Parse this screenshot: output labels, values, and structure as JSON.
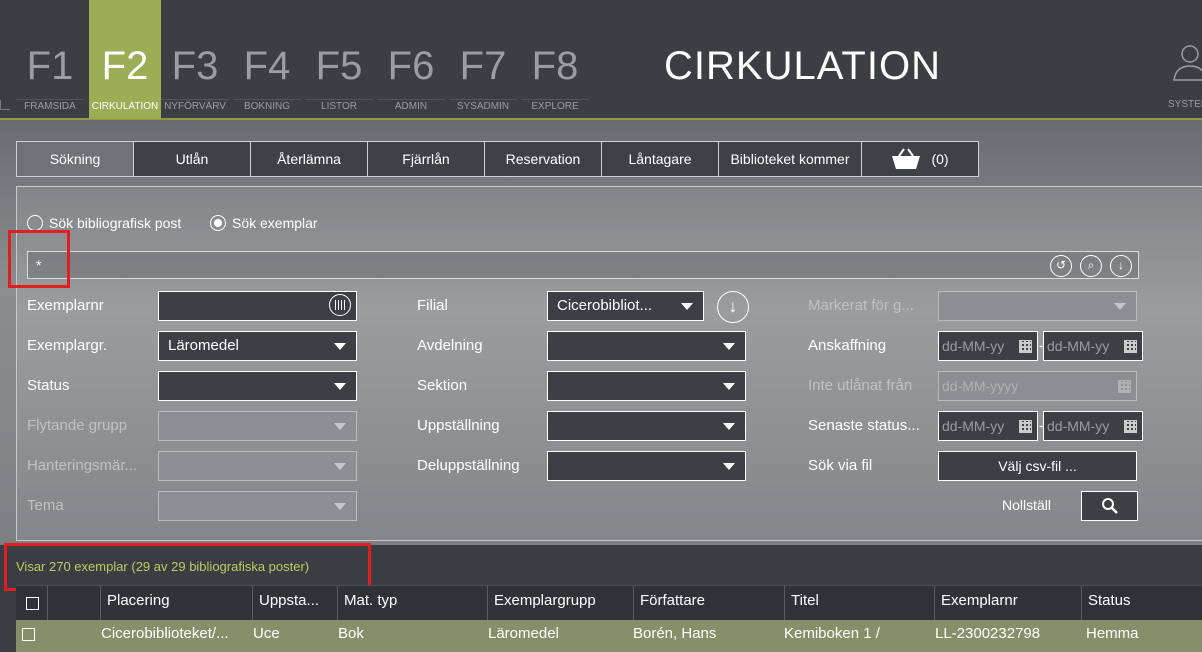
{
  "nav": {
    "keys": [
      {
        "key": "F1",
        "label": "FRAMSIDA"
      },
      {
        "key": "F2",
        "label": "CIRKULATION"
      },
      {
        "key": "F3",
        "label": "NYFÖRVÄRV"
      },
      {
        "key": "F4",
        "label": "BOKNING"
      },
      {
        "key": "F5",
        "label": "LISTOR"
      },
      {
        "key": "F6",
        "label": "ADMIN"
      },
      {
        "key": "F7",
        "label": "SYSADMIN"
      },
      {
        "key": "F8",
        "label": "EXPLORE"
      }
    ],
    "active": "F2",
    "title": "CIRKULATION",
    "system_label": "SYSTEM"
  },
  "tabs": [
    "Sökning",
    "Utlån",
    "Återlämna",
    "Fjärrlån",
    "Reservation",
    "Låntagare",
    "Biblioteket kommer"
  ],
  "basket": {
    "count": "(0)"
  },
  "search": {
    "radio_bib": "Sök bibliografisk post",
    "radio_ex": "Sök exemplar",
    "query": "*"
  },
  "form": {
    "exemplarnr": {
      "label": "Exemplarnr",
      "value": ""
    },
    "exemplargr": {
      "label": "Exemplargr.",
      "value": "Läromedel"
    },
    "status": {
      "label": "Status",
      "value": ""
    },
    "flytande": {
      "label": "Flytande grupp",
      "value": ""
    },
    "hantering": {
      "label": "Hanteringsmär...",
      "value": ""
    },
    "tema": {
      "label": "Tema",
      "value": ""
    },
    "filial": {
      "label": "Filial",
      "value": "Cicerobibliot..."
    },
    "avdelning": {
      "label": "Avdelning",
      "value": ""
    },
    "sektion": {
      "label": "Sektion",
      "value": ""
    },
    "uppstallning": {
      "label": "Uppställning",
      "value": ""
    },
    "deluppstallning": {
      "label": "Deluppställning",
      "value": ""
    },
    "markerat": {
      "label": "Markerat för g...",
      "value": ""
    },
    "anskaffning": {
      "label": "Anskaffning",
      "from": "dd-MM-yy",
      "to": "dd-MM-yy"
    },
    "inte_utlanat": {
      "label": "Inte utlånat från",
      "value": "dd-MM-yyyy"
    },
    "senaste_status": {
      "label": "Senaste status...",
      "from": "dd-MM-yy",
      "to": "dd-MM-yy"
    },
    "sok_via_fil": {
      "label": "Sök via fil",
      "button": "Välj csv-fil ..."
    },
    "reset": "Nollställ",
    "dash": "-"
  },
  "results": {
    "summary": "Visar 270 exemplar (29 av 29 bibliografiska poster)",
    "columns": [
      "Placering",
      "Uppsta...",
      "Mat. typ",
      "Exemplargrupp",
      "Författare",
      "Titel",
      "Exemplarnr",
      "Status"
    ],
    "rows": [
      [
        "Cicerobiblioteket/...",
        "Uce",
        "Bok",
        "Läromedel",
        "Borén, Hans",
        "Kemiboken 1 /",
        "LL-2300232798",
        "Hemma"
      ]
    ]
  },
  "colors": {
    "accent": "#9aae55",
    "results_text": "#b9cd65",
    "highlight_box": "#e02020",
    "selected_row": "#858f69"
  }
}
